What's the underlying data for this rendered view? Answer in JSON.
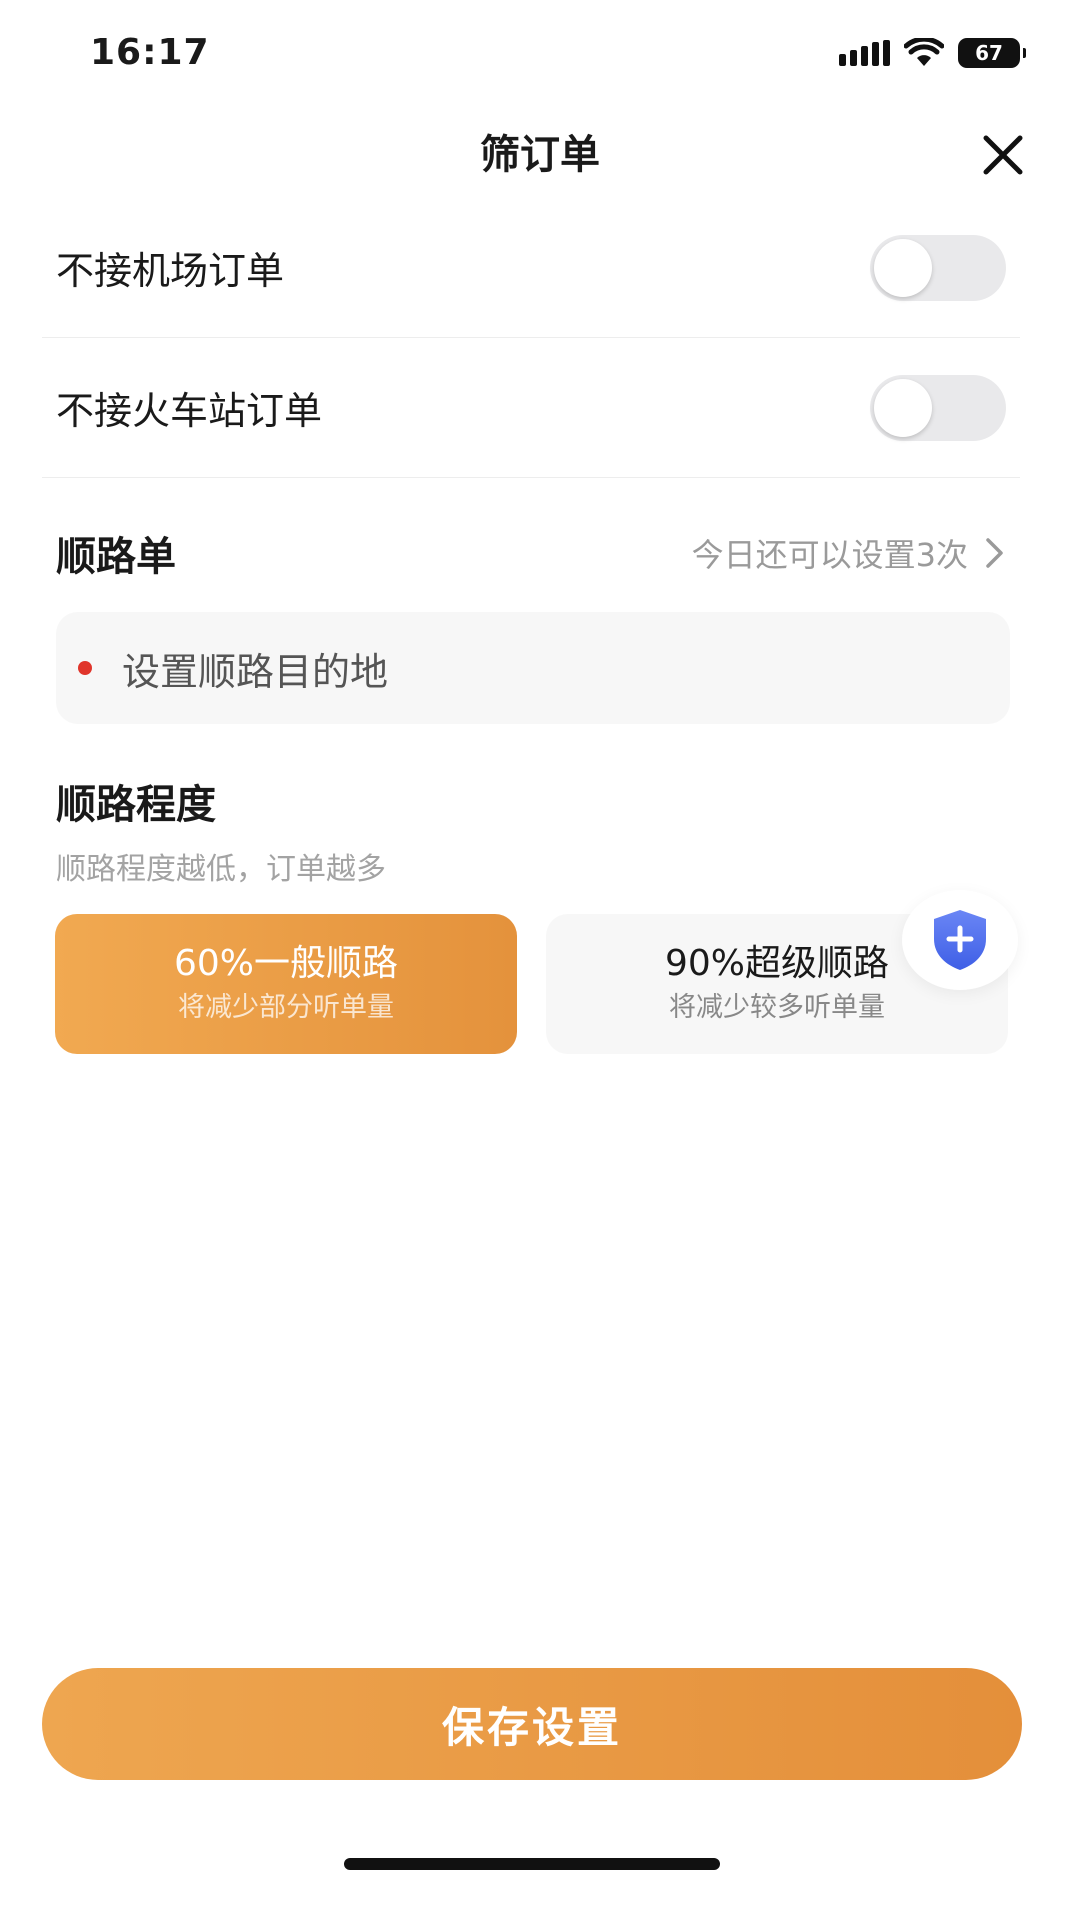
{
  "status_bar": {
    "time": "16:17",
    "battery": "67",
    "icons": [
      "signal-icon",
      "wifi-icon",
      "battery-icon"
    ]
  },
  "header": {
    "title": "筛订单",
    "close_icon": "close-icon"
  },
  "toggles": [
    {
      "label": "不接机场订单",
      "on": false
    },
    {
      "label": "不接火车站订单",
      "on": false
    }
  ],
  "route": {
    "title": "顺路单",
    "remaining_text": "今日还可以设置3次",
    "destination_placeholder": "设置顺路目的地"
  },
  "degree": {
    "title": "顺路程度",
    "subtitle": "顺路程度越低，订单越多",
    "options": [
      {
        "title": "60%一般顺路",
        "desc": "将减少部分听单量",
        "selected": true
      },
      {
        "title": "90%超级顺路",
        "desc": "将减少较多听单量",
        "selected": false
      }
    ],
    "badge_icon": "shield-plus-icon"
  },
  "footer": {
    "save_label": "保存设置"
  },
  "colors": {
    "accent": "#E8963F",
    "toggle_off": "#E9E9EB",
    "dot_red": "#E0352B",
    "shield_blue": "#4A6CF0"
  }
}
